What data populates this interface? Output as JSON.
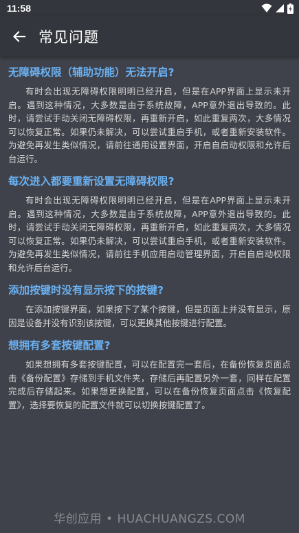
{
  "status_bar": {
    "time": "11:58"
  },
  "toolbar": {
    "title": "常见问题"
  },
  "faq": [
    {
      "question": "无障碍权限（辅助功能）无法开启?",
      "answer": "有时会出现无障碍权限明明已经开启，但是在APP界面上显示未开启。遇到这种情况，大多数是由于系统故障，APP意外退出导致的。此时，请尝试手动关闭无障碍权限，再重新开启，如此重复两次，大多情况可以恢复正常。如果仍未解决，可以尝试重启手机，或者重新安装软件。为避免再发生类似情况，请前往通用设置界面，开启自启动权限和允许后台运行。"
    },
    {
      "question": "每次进入都要重新设置无障碍权限?",
      "answer": "有时会出现无障碍权限明明已经开启，但是在APP界面上显示未开启。遇到这种情况，大多数是由于系统故障，APP意外退出导致的。此时，请尝试手动关闭无障碍权限，再重新开启，如此重复两次，大多情况可以恢复正常。如果仍未解决，可以尝试重启手机，或者重新安装软件。为避免再发生类似情况，请前往手机应用启动管理界面，开启自启动权限和允许后台运行。"
    },
    {
      "question": "添加按键时没有显示按下的按键?",
      "answer": "在添加按键界面，如果按下了某个按键，但是页面上并没有显示，原因是设备并没有识别该按键，可以更换其他按键进行配置。"
    },
    {
      "question": "想拥有多套按键配置?",
      "answer": "如果想拥有多套按键配置，可以在配置完一套后，在备份恢复页面点击《备份配置》存储到手机文件夹，存储后再配置另外一套，同样在配置完成后存储起来。如果想更换配置，可以在备份恢复页面点击《恢复配置》，选择要恢复的配置文件就可以切换按键配置了。"
    }
  ],
  "watermark": "华创应用 • HUACHUANGZS.COM"
}
